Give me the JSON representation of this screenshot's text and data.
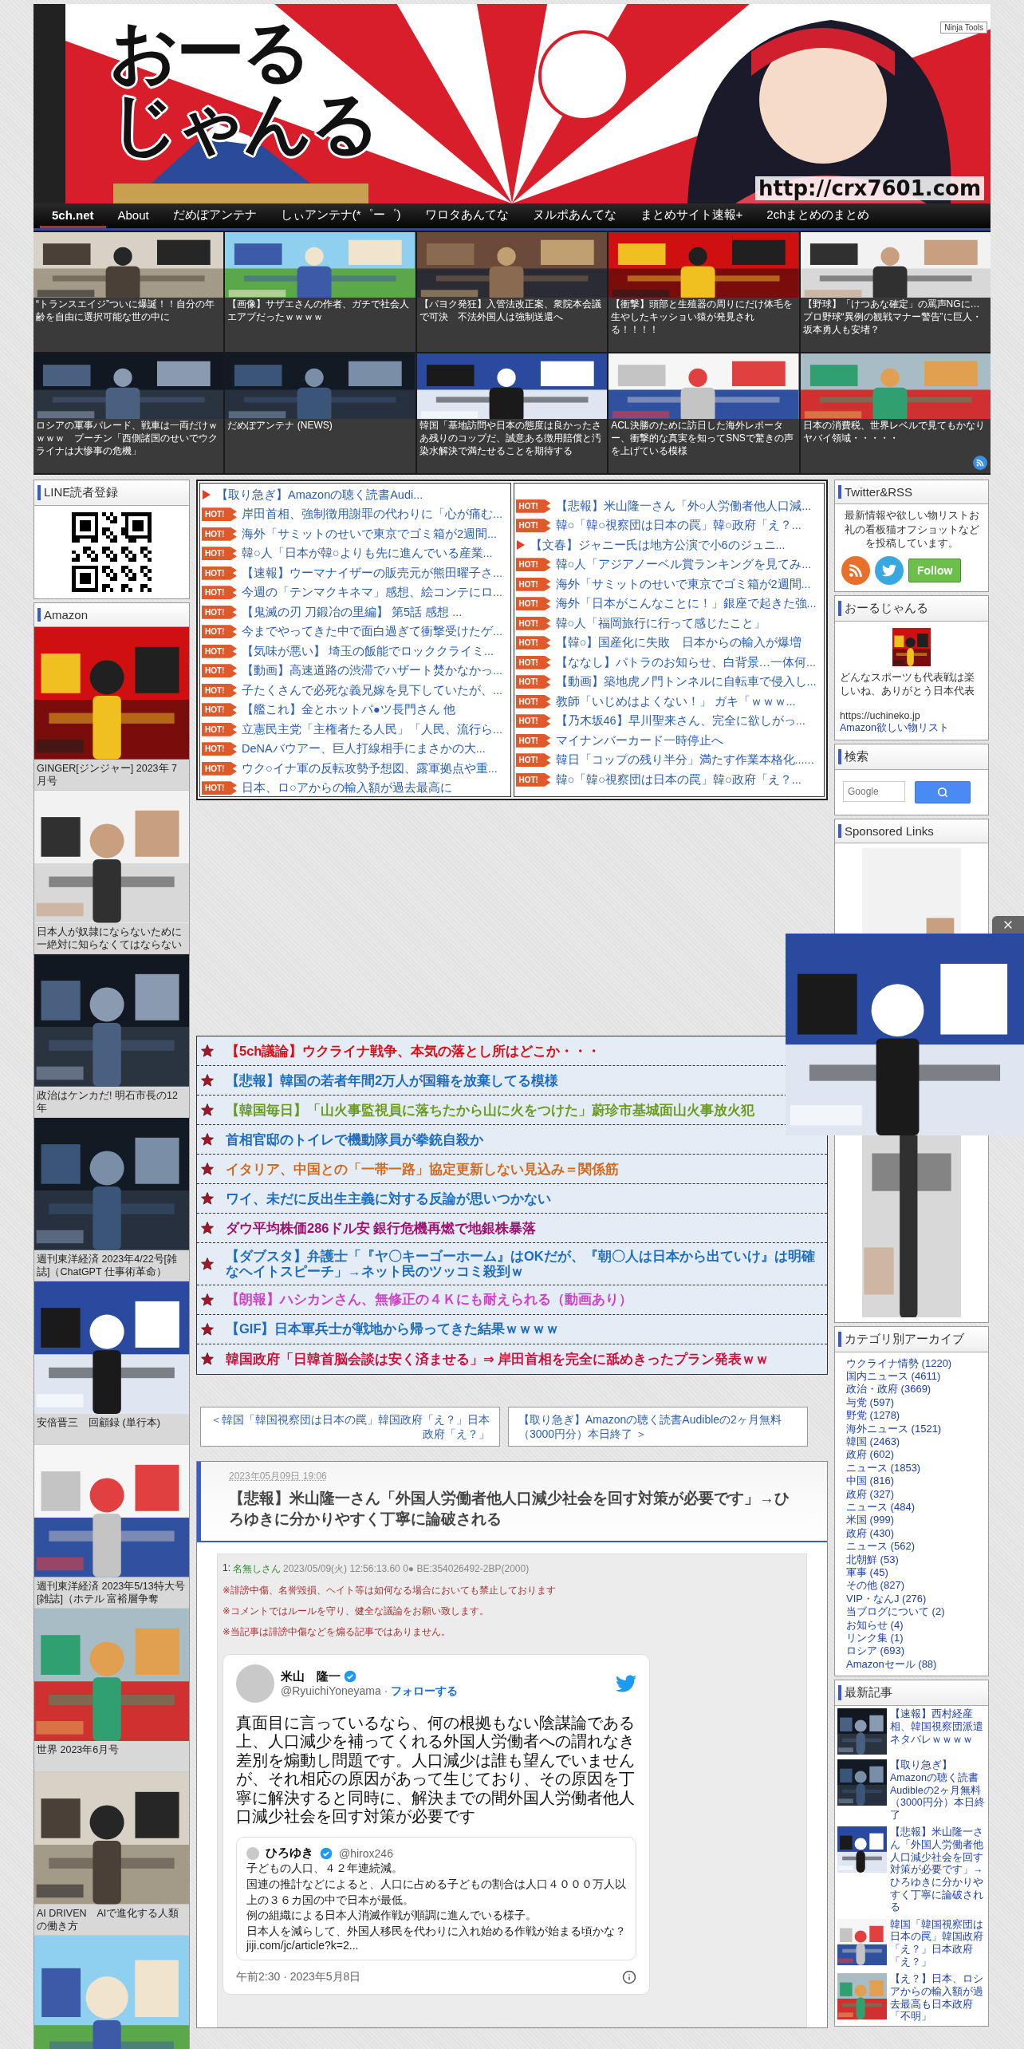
{
  "header": {
    "title_lines": [
      "おーる",
      "じゃんる"
    ],
    "url": "http://crx7601.com",
    "badge": "Ninja Tools"
  },
  "nav": [
    {
      "label": "5ch.net",
      "selected": true
    },
    {
      "label": "About",
      "selected": false
    },
    {
      "label": "だめぽアンテナ",
      "selected": false
    },
    {
      "label": "しぃアンテナ(*゜ー゜)",
      "selected": false
    },
    {
      "label": "ワロタあんてな",
      "selected": false
    },
    {
      "label": "ヌルポあんてな",
      "selected": false
    },
    {
      "label": "まとめサイト速報+",
      "selected": false
    },
    {
      "label": "2chまとめのまとめ",
      "selected": false
    }
  ],
  "thumbnails": [
    {
      "caption": "“トランスエイジ”ついに爆誕！！自分の年齢を自由に選択可能な世の中に"
    },
    {
      "caption": "【画像】サザエさんの作者、ガチで社会人エアプだったｗｗｗｗ"
    },
    {
      "caption": "【パヨク発狂】入管法改正案、衆院本会議で可決　不法外国人は強制送還へ"
    },
    {
      "caption": "【衝撃】頭部と生殖器の周りにだけ体毛を生やしたキッショい猿が発見される！！！！"
    },
    {
      "caption": "【野球】「けつあな確定」の罵声NGに…プロ野球“異例の観戦マナー警告”に巨人・坂本勇人も安堵？"
    },
    {
      "caption": "ロシアの軍事パレード、戦車は一両だけｗｗｗｗ　プーチン「西側諸国のせいでウクライナは大惨事の危機」"
    },
    {
      "caption": "だめぽアンテナ (NEWS)"
    },
    {
      "caption": "韓国「基地訪問や日本の態度は良かったさあ残りのコップだ、誠意ある徴用賠償と汚染水解決で満たせることを期待する"
    },
    {
      "caption": "ACL決勝のために訪日した海外レポーター、衝撃的な真実を知ってSNSで驚きの声を上げている模様"
    },
    {
      "caption": "日本の消費税、世界レベルで見てもかなりヤバイ領域・・・・・"
    }
  ],
  "link_columns": [
    [
      {
        "kind": "arrow",
        "text": "【取り急ぎ】Amazonの聴く読書Audi..."
      },
      {
        "kind": "hot",
        "badge": "HOT!",
        "text": "岸田首相、強制徴用謝罪の代わりに「心が痛む..."
      },
      {
        "kind": "hot",
        "badge": "HOT!",
        "text": "海外「サミットのせいで東京でゴミ箱が2週間..."
      },
      {
        "kind": "hot",
        "badge": "HOT!",
        "text": "韓○人「日本が韓○よりも先に進んでいる産業..."
      },
      {
        "kind": "hot",
        "badge": "HOT!",
        "text": "【速報】ウーマナイザーの販売元が熊田曜子さ..."
      },
      {
        "kind": "hot",
        "badge": "HOT!",
        "text": "今週の「テンマクキネマ」感想、絵コンテにロ..."
      },
      {
        "kind": "hot",
        "badge": "HOT!",
        "text": "【鬼滅の刃 刀鍛冶の里編】 第5話 感想 ..."
      },
      {
        "kind": "hot",
        "badge": "HOT!",
        "text": "今までやってきた中で面白過ぎて衝撃受けたゲ..."
      },
      {
        "kind": "hot",
        "badge": "HOT!",
        "text": "【気味が悪い】 埼玉の飯能でロッククライミ..."
      },
      {
        "kind": "hot",
        "badge": "HOT!",
        "text": "【動画】高速道路の渋滞でハザート焚かなかっ..."
      },
      {
        "kind": "hot",
        "badge": "HOT!",
        "text": "子たくさんで必死な義兄嫁を見下していたが、..."
      },
      {
        "kind": "hot",
        "badge": "HOT!",
        "text": "【艦これ】金とホットパ●ツ長門さん 他"
      },
      {
        "kind": "hot",
        "badge": "HOT!",
        "text": "立憲民主党「主権者たる人民」「人民、流行ら..."
      },
      {
        "kind": "hot",
        "badge": "HOT!",
        "text": "DeNAバウアー、巨人打線相手にまさかの大..."
      },
      {
        "kind": "hot",
        "badge": "HOT!",
        "text": "ウク○イナ軍の反転攻勢予想図、露軍拠点や重..."
      },
      {
        "kind": "hot",
        "badge": "HOT!",
        "text": "日本、ロ○アからの輸入額が過去最高に"
      }
    ],
    [
      {
        "kind": "hot",
        "badge": "HOT!",
        "text": "【悲報】米山隆一さん「外○人労働者他人口減..."
      },
      {
        "kind": "hot",
        "badge": "HOT!",
        "text": "韓○「韓○視察団は日本の罠」韓○政府「え？..."
      },
      {
        "kind": "arrow",
        "text": "【文春】ジャニー氏は地方公演で小6のジュニ..."
      },
      {
        "kind": "hot",
        "badge": "HOT!",
        "text": "韓○人「アジアノーベル賞ランキングを見てみ..."
      },
      {
        "kind": "hot",
        "badge": "HOT!",
        "text": "海外「サミットのせいで東京でゴミ箱が2週間..."
      },
      {
        "kind": "hot",
        "badge": "HOT!",
        "text": "海外「日本がこんなことに！」銀座で起きた強..."
      },
      {
        "kind": "hot",
        "badge": "HOT!",
        "text": "韓○人「福岡旅行に行って感じたこと」"
      },
      {
        "kind": "hot",
        "badge": "HOT!",
        "text": "【韓○】国産化に失敗　日本からの輸入が爆増"
      },
      {
        "kind": "hot",
        "badge": "HOT!",
        "text": "【ななし】パトラのお知らせ、白背景…一体何..."
      },
      {
        "kind": "hot",
        "badge": "HOT!",
        "text": "【動画】築地虎ノ門トンネルに自転車で侵入し..."
      },
      {
        "kind": "hot",
        "badge": "HOT!",
        "text": "教師「いじめはよくない！」 ガキ「ｗｗｗ..."
      },
      {
        "kind": "hot",
        "badge": "HOT!",
        "text": "【乃木坂46】早川聖来さん、完全に欲しがっ..."
      },
      {
        "kind": "hot",
        "badge": "HOT!",
        "text": "マイナンバーカード一時停止へ"
      },
      {
        "kind": "hot",
        "badge": "HOT!",
        "text": "韓日「コップの残り半分」満たす作業本格化......"
      },
      {
        "kind": "hot",
        "badge": "HOT!",
        "text": "韓○「韓○視察団は日本の罠」韓○政府「え？..."
      }
    ]
  ],
  "featured": [
    {
      "text": "【5ch議論】ウクライナ戦争、本気の落とし所はどこか・・・",
      "color": "#e00a14"
    },
    {
      "text": "【悲報】韓国の若者年間2万人が国籍を放棄してる模様",
      "color": "#1e6cc0"
    },
    {
      "text": "【韓国毎日】「山火事監視員に落ちたから山に火をつけた」蔚珍市基城面山火事放火犯",
      "color": "#6a9a1e"
    },
    {
      "text": "首相官邸のトイレで機動隊員が拳銃自殺か",
      "color": "#1e6cc0"
    },
    {
      "text": "イタリア、中国との「一帯一路」協定更新しない見込み＝関係筋",
      "color": "#d2691e"
    },
    {
      "text": "ワイ、未だに反出生主義に対する反論が思いつかない",
      "color": "#1e6cc0"
    },
    {
      "text": "ダウ平均株価286ドル安 銀行危機再燃で地銀株暴落",
      "color": "#a0106e"
    },
    {
      "text": "【ダブスタ】弁護士「『ヤ〇キーゴーホーム』はOKだが、『朝〇人は日本から出ていけ』は明確なヘイトスピーチ」→ネット民のツッコミ殺到ｗ",
      "color": "#1e6cc0"
    },
    {
      "text": "【朗報】ハシカンさん、無修正の４Ｋにも耐えられる（動画あり）",
      "color": "#d040c8"
    },
    {
      "text": "【GIF】日本軍兵士が戦地から帰ってきた結果ｗｗｗｗ",
      "color": "#1e6cc0"
    },
    {
      "text": "韓国政府「日韓首脳会談は安く済ませる」⇒ 岸田首相を完全に舐めきったプラン発表ｗｗ",
      "color": "#d0103a"
    }
  ],
  "pager": {
    "prev": "＜韓国「韓国視察団は日本の罠」韓国政府「え？」日本政府「え？」",
    "next": "【取り急ぎ】Amazonの聴く読書Audibleの2ヶ月無料（3000円分）本日終了 ＞"
  },
  "article": {
    "date": "2023年05月09日 19:06",
    "title": "【悲報】米山隆一さん「外国人労働者他人口減少社会を回す対策が必要です」→ひろゆきに分かりやすく丁寧に論破される",
    "post": {
      "number": "1:",
      "author": "名無しさん",
      "meta": "2023/05/09(火) 12:56:13.60 0● BE:354026492-2BP(2000)"
    },
    "notes": [
      "※誹謗中傷、名誉毀損、ヘイト等は如何なる場合においても禁止しております",
      "※コメントではルールを守り、健全な議論をお願い致します。",
      "※当記事は誹謗中傷などを煽る記事ではありません。"
    ],
    "tweet": {
      "name": "米山　隆一",
      "handle": "@RyuichiYoneyama",
      "separator": "·",
      "follow": "フォローする",
      "text": "真面目に言っているなら、何の根拠もない陰謀論である上、人口減少を補ってくれる外国人労働者への謂れなき差別を煽動し問題です。人口減少は誰も望んでいませんが、それ相応の原因があって生じており、その原因を丁寧に解決すると同時に、解決までの間外国人労働者他人口減少社会を回す対策が必要です",
      "quote": {
        "name": "ひろゆき",
        "handle": "@hirox246",
        "lines": [
          "子どもの人口、４２年連続減。",
          "国連の推計などによると、人口に占める子どもの割合は人口４０００万人以上の３６カ国の中で日本が最低。",
          "例の組織による日本人消滅作戦が順調に進んでいる様子。",
          "日本人を減らして、外国人移民を代わりに入れ始める作戦が始まる頃かな？"
        ],
        "link": "jiji.com/jc/article?k=2..."
      },
      "time": "午前2:30 · 2023年5月8日"
    }
  },
  "left_sidebar": {
    "line": {
      "title": "LINE読者登録"
    },
    "amazon": {
      "title": "Amazon",
      "items": [
        {
          "caption": "GINGER[ジンジャー] 2023年 7月号"
        },
        {
          "caption": "日本人が奴隷にならないために一絶対に知らなくてはならない"
        },
        {
          "caption": "政治はケンカだ! 明石市長の12年"
        },
        {
          "caption": "週刊東洋経済 2023年4/22号[雑誌]（ChatGPT 仕事術革命）"
        },
        {
          "caption": "安倍晋三　回顧録 (単行本)"
        },
        {
          "caption": "週刊東洋経済 2023年5/13特大号[雑誌]（ホテル 富裕層争奪"
        },
        {
          "caption": "世界 2023年6月号"
        },
        {
          "caption": "AI DRIVEN　AIで進化する人類の働き方"
        }
      ]
    }
  },
  "right_sidebar": {
    "twitter": {
      "title": "Twitter&RSS",
      "text": "最新情報や欲しい物リストお礼の看板猫オフショットなどを投稿しています。",
      "follow": "Follow"
    },
    "profile": {
      "title": "おーるじゃんる",
      "text": "どんなスポーツも代表戦は楽しいね、ありがとう日本代表",
      "url": "https://uchineko.jp",
      "link": "Amazon欲しい物リスト"
    },
    "search": {
      "title": "検索",
      "placeholder": "Google"
    },
    "sponsored": {
      "title": "Sponsored Links"
    },
    "categories": {
      "title": "カテゴリ別アーカイブ",
      "items": [
        "ウクライナ情勢 (1220)",
        "国内ニュース (4611)",
        "政治・政府 (3669)",
        "与党 (597)",
        "野党 (1278)",
        "海外ニュース (1521)",
        "韓国 (2463)",
        "政府 (602)",
        "ニュース (1853)",
        "中国 (816)",
        "政府 (327)",
        "ニュース (484)",
        "米国 (999)",
        "政府 (430)",
        "ニュース (562)",
        "北朝鮮 (53)",
        "軍事 (45)",
        "その他 (827)",
        "VIP・なんJ (276)",
        "当ブログについて (2)",
        "お知らせ (4)",
        "リンク集 (1)",
        "ロシア (693)",
        "Amazonセール (88)"
      ]
    },
    "latest": {
      "title": "最新記事",
      "items": [
        "【速報】西村経産相、韓国視察団派遣ネタバレｗｗｗｗ",
        "【取り急ぎ】Amazonの聴く読書Audibleの2ヶ月無料（3000円分）本日終了",
        "【悲報】米山隆一さん「外国人労働者他人口減少社会を回す対策が必要です」→ひろゆきに分かりやすく丁寧に論破される",
        "韓国「韓国視察団は日本の罠」韓国政府「え？」日本政府「え？」",
        "【え？】日本、ロシアからの輸入額が過去最高も日本政府「不明」"
      ]
    }
  }
}
